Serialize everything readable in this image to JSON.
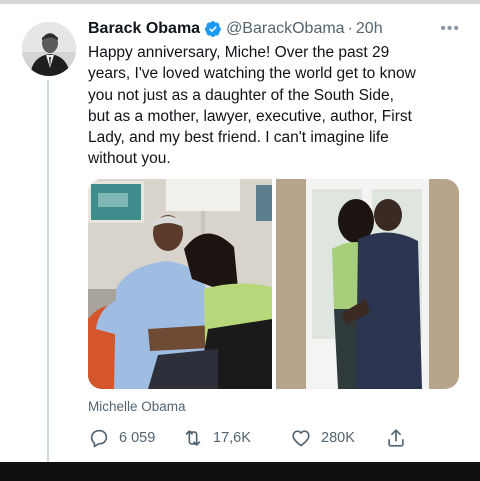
{
  "tweet": {
    "author_name": "Barack Obama",
    "handle": "@BarackObama",
    "separator": "·",
    "time": "20h",
    "more_label": "•••",
    "text": "Happy anniversary, Miche! Over the past 29\nyears, I've loved watching the world get to know\nyou not just as a daughter of the South Side,\nbut as a mother, lawyer, executive, author, First\nLady, and my best friend. I can't imagine life\nwithout you.",
    "media_caption": "Michelle Obama",
    "stats": {
      "replies": "6 059",
      "retweets": "17,6K",
      "likes": "280K"
    }
  },
  "colors": {
    "verified": "#1d9bf0",
    "secondary_text": "#536471",
    "thread_line": "#cfd9de"
  },
  "icons": {
    "verified": "verified-badge-icon",
    "reply": "reply-icon",
    "retweet": "retweet-icon",
    "like": "heart-icon",
    "share": "share-icon",
    "more": "more-icon"
  }
}
